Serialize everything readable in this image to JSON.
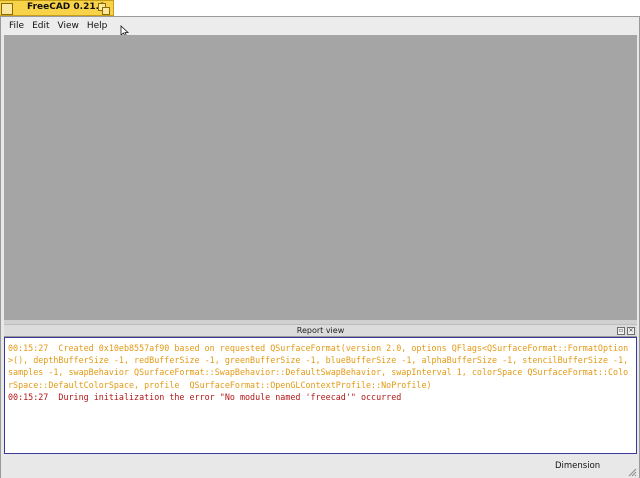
{
  "window": {
    "title": "FreeCAD 0.21.0"
  },
  "menubar": {
    "items": [
      "File",
      "Edit",
      "View",
      "Help"
    ]
  },
  "report_view": {
    "title": "Report view",
    "lines": [
      {
        "type": "warning",
        "text": "00:15:27  Created 0x10eb8557af90 based on requested QSurfaceFormat(version 2.0, options QFlags<QSurfaceFormat::FormatOption>(), depthBufferSize -1, redBufferSize -1, greenBufferSize -1, blueBufferSize -1, alphaBufferSize -1, stencilBufferSize -1, samples -1, swapBehavior QSurfaceFormat::SwapBehavior::DefaultSwapBehavior, swapInterval 1, colorSpace QSurfaceFormat::ColorSpace::DefaultColorSpace, profile  QSurfaceFormat::OpenGLContextProfile::NoProfile)"
      },
      {
        "type": "error",
        "text": "00:15:27  During initialization the error \"No module named 'freecad'\" occurred"
      }
    ]
  },
  "statusbar": {
    "units": "Dimension"
  },
  "colors": {
    "title_tab": "#f8d34a",
    "workspace": "#a5a5a5",
    "warning_text": "#e39a14",
    "error_text": "#b01818"
  },
  "icons": [
    "app-icon",
    "restore-icon",
    "mouse-cursor-icon",
    "float-icon",
    "close-icon",
    "size-grip-icon"
  ]
}
